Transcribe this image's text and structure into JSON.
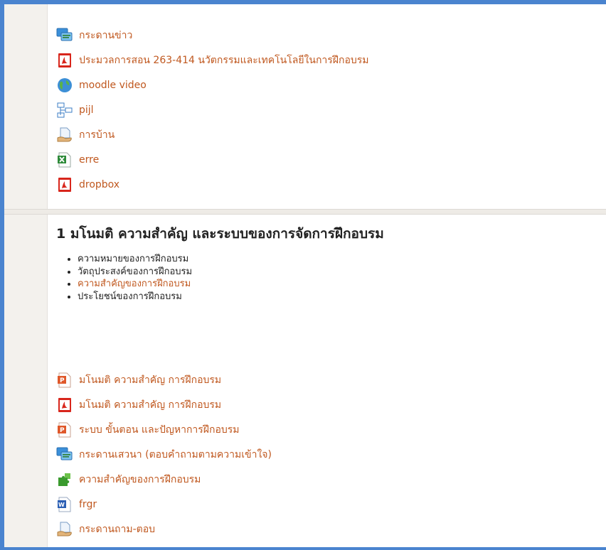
{
  "section0": {
    "activities": [
      {
        "label": "กระดานข่าว",
        "icon": "forum-icon"
      },
      {
        "label": "ประมวลการสอน 263-414 นวัตกรรมและเทคโนโลยีในการฝึกอบรม",
        "icon": "pdf-icon"
      },
      {
        "label": "moodle video",
        "icon": "url-globe-icon"
      },
      {
        "label": "pijl",
        "icon": "folder-tree-icon"
      },
      {
        "label": "การบ้าน",
        "icon": "assignment-icon"
      },
      {
        "label": "erre",
        "icon": "excel-icon"
      },
      {
        "label": "dropbox",
        "icon": "pdf-icon"
      }
    ]
  },
  "section1": {
    "title": "1 มโนมติ ความสำคัญ และระบบของการจัดการฝึกอบรม",
    "summary_items": [
      {
        "text": "ความหมายของการฝึกอบรม",
        "linked": false
      },
      {
        "text": "วัตถุประสงค์ของการฝึกอบรม",
        "linked": false
      },
      {
        "text": "ความสำคัญของการฝึกอบรม",
        "linked": true
      },
      {
        "text": "ประโยชน์ของการฝึกอบรม",
        "linked": false
      }
    ],
    "activities": [
      {
        "label": "มโนมติ ความสำคัญ การฝึกอบรม",
        "icon": "powerpoint-icon"
      },
      {
        "label": "มโนมติ ความสำคัญ การฝึกอบรม",
        "icon": "pdf-icon"
      },
      {
        "label": "ระบบ ขั้นตอน และปัญหาการฝึกอบรม",
        "icon": "powerpoint-icon"
      },
      {
        "label": "กระดานเสวนา (ตอบคำถามตามความเข้าใจ)",
        "icon": "forum-icon"
      },
      {
        "label": "ความสำคัญของการฝึกอบรม",
        "icon": "scorm-puzzle-icon"
      },
      {
        "label": "frgr",
        "icon": "word-icon"
      },
      {
        "label": "กระดานถาม-ตอบ",
        "icon": "assignment-icon"
      }
    ]
  },
  "colors": {
    "accent_border": "#4a84cf",
    "link": "#c0581f",
    "gutter": "#f3f1ed"
  }
}
